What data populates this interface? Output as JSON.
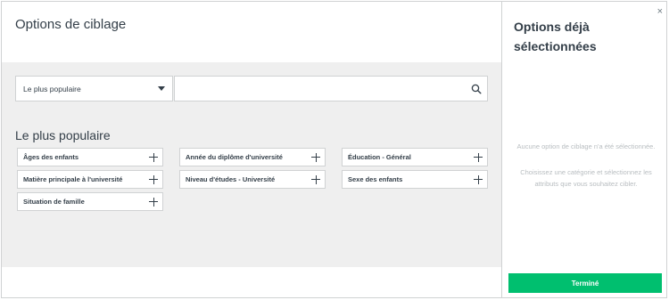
{
  "dialog": {
    "title": "Options de ciblage"
  },
  "filter": {
    "selected_option": "Le plus populaire",
    "search_value": "",
    "search_placeholder": ""
  },
  "section": {
    "title": "Le plus populaire"
  },
  "options": [
    {
      "label": "Âges des enfants"
    },
    {
      "label": "Année du diplôme d'université"
    },
    {
      "label": "Éducation - Général"
    },
    {
      "label": "Matière principale à l'université"
    },
    {
      "label": "Niveau d'études - Université"
    },
    {
      "label": "Sexe des enfants"
    },
    {
      "label": "Situation de famille"
    }
  ],
  "selected_panel": {
    "title": "Options déjà sélectionnées",
    "empty_message": "Aucune option de ciblage n'a été sélectionnée.",
    "hint": "Choisissez une catégorie et sélectionnez les attributs que vous souhaitez cibler.",
    "done_label": "Terminé",
    "close_glyph": "×"
  },
  "colors": {
    "accent": "#00bf6f",
    "gray_area": "#efefef",
    "text": "#333e48"
  }
}
